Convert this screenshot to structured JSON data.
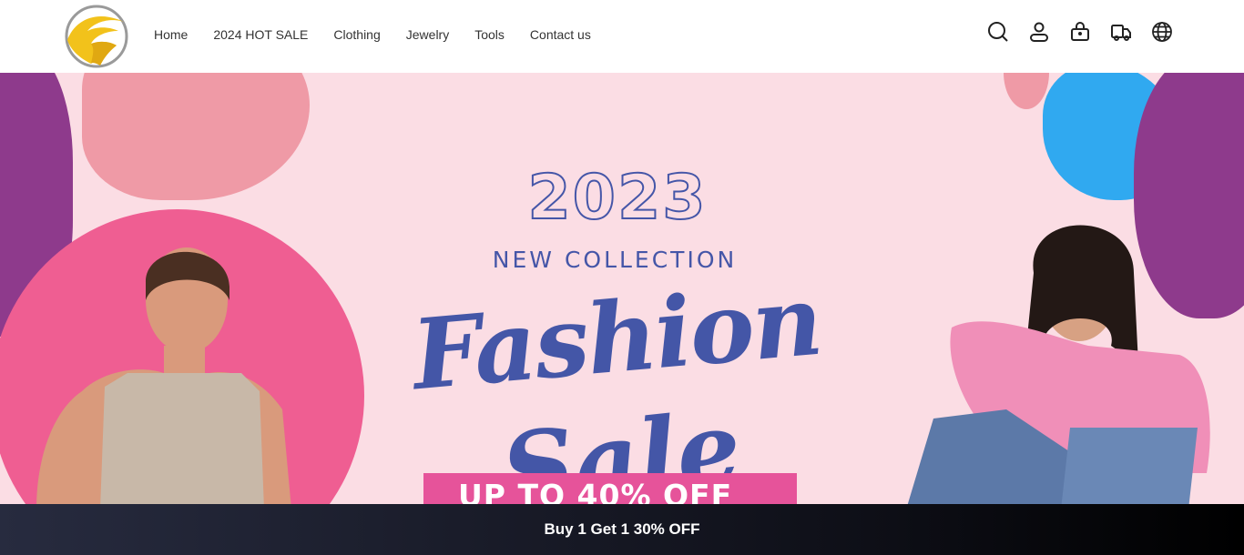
{
  "nav": {
    "items": [
      {
        "label": "Home"
      },
      {
        "label": "2024 HOT SALE"
      },
      {
        "label": "Clothing"
      },
      {
        "label": "Jewelry"
      },
      {
        "label": "Tools"
      },
      {
        "label": "Contact us"
      }
    ]
  },
  "icons": [
    "search-icon",
    "account-icon",
    "cart-icon",
    "track-order-icon",
    "language-icon"
  ],
  "banner": {
    "year": "2023",
    "subtitle": "NEW COLLECTION",
    "headline_1": "Fashion",
    "headline_2": "Sale",
    "offer": "UP TO 40% OFF"
  },
  "promo": {
    "text": "Buy 1 Get 1 30% OFF"
  },
  "colors": {
    "banner_bg": "#fbdde4",
    "accent_blue": "#4456a7",
    "offer_pink": "#e6539a",
    "promo_dark": "#0e0f17"
  }
}
